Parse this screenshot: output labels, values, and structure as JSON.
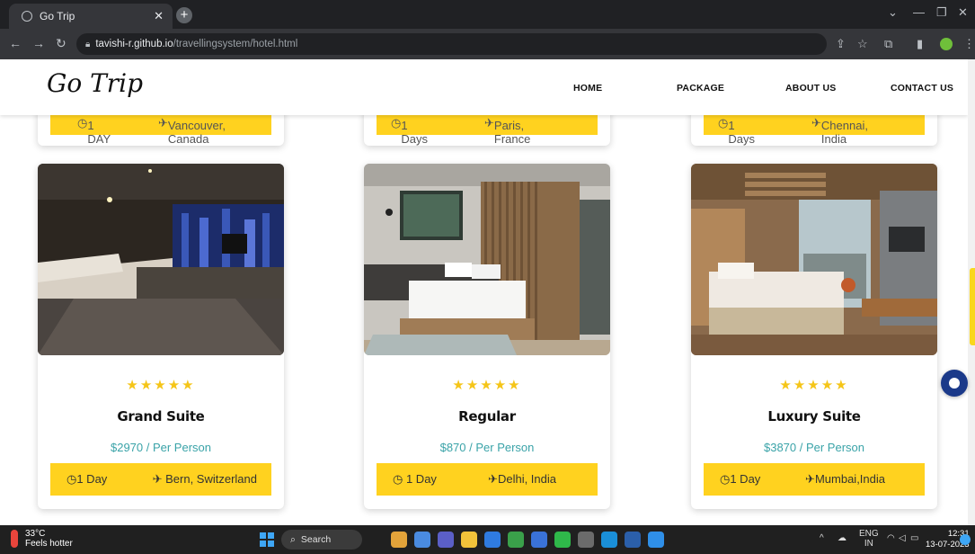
{
  "browser": {
    "tab_title": "Go Trip",
    "url_host": "tavishi-r.github.io",
    "url_path": "/travellingsystem/hotel.html"
  },
  "site": {
    "logo": "Go Trip",
    "nav": [
      "HOME",
      "PACKAGE",
      "ABOUT US",
      "CONTACT US"
    ]
  },
  "top_cards": [
    {
      "duration": "1 DAY",
      "location": "Vancouver, Canada"
    },
    {
      "duration": "1 Days",
      "location": "Paris, France"
    },
    {
      "duration": "1 Days",
      "location": "Chennai, India"
    }
  ],
  "hotels": [
    {
      "rating": 5,
      "stars": "★★★★★",
      "name": "Grand Suite",
      "price": "$2970 / Per Person",
      "duration": "1 Day",
      "location": "Bern, Switzerland"
    },
    {
      "rating": 5,
      "stars": "★★★★★",
      "name": "Regular",
      "price": "$870 / Per Person",
      "duration": "1 Day",
      "location": "Delhi, India"
    },
    {
      "rating": 5,
      "stars": "★★★★★",
      "name": "Luxury Suite",
      "price": "$3870 / Per Person",
      "duration": "1 Day",
      "location": "Mumbai,India"
    }
  ],
  "taskbar": {
    "temperature": "33°C",
    "weather_text": "Feels hotter",
    "search_label": "Search",
    "lang_line1": "ENG",
    "lang_line2": "IN",
    "time": "12:31",
    "date": "13-07-2023"
  },
  "colors": {
    "accent_yellow": "#ffd21f",
    "price_teal": "#3aa3a8",
    "star": "#f5c518"
  }
}
